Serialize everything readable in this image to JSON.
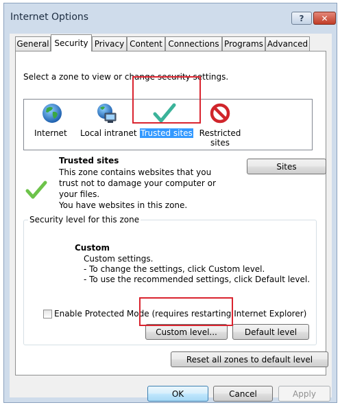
{
  "window": {
    "title": "Internet Options",
    "help_glyph": "?",
    "close_glyph": "✕"
  },
  "tabs": [
    {
      "label": "General"
    },
    {
      "label": "Security",
      "selected": true
    },
    {
      "label": "Privacy"
    },
    {
      "label": "Content"
    },
    {
      "label": "Connections"
    },
    {
      "label": "Programs"
    },
    {
      "label": "Advanced"
    }
  ],
  "security": {
    "zone_prompt": "Select a zone to view or change security settings.",
    "zones": [
      {
        "label": "Internet",
        "icon": "globe-icon"
      },
      {
        "label": "Local intranet",
        "icon": "intranet-icon"
      },
      {
        "label": "Trusted sites",
        "icon": "checkmark-icon",
        "selected": true
      },
      {
        "label": "Restricted sites",
        "label_line1": "Restricted",
        "label_line2": "sites",
        "icon": "restricted-icon"
      }
    ],
    "zone_info": {
      "title": "Trusted sites",
      "desc_lines": [
        "This zone contains websites that you",
        "trust not to damage your computer or",
        "your files.",
        "You have websites in this zone."
      ]
    },
    "sites_button": "Sites",
    "level_group": {
      "title": "Security level for this zone",
      "level_name": "Custom",
      "lines": [
        "Custom settings.",
        "- To change the settings, click Custom level.",
        "- To use the recommended settings, click Default level."
      ]
    },
    "protected_mode": {
      "label": "Enable Protected Mode (requires restarting Internet Explorer)",
      "checked": false
    },
    "custom_level_button": "Custom level...",
    "default_level_button": "Default level",
    "reset_all_button": "Reset all zones to default level"
  },
  "footer": {
    "ok": "OK",
    "cancel": "Cancel",
    "apply": "Apply"
  },
  "colors": {
    "selection": "#3399ff",
    "highlight_box": "#d9232e",
    "checkmark": "#3bb39a"
  }
}
